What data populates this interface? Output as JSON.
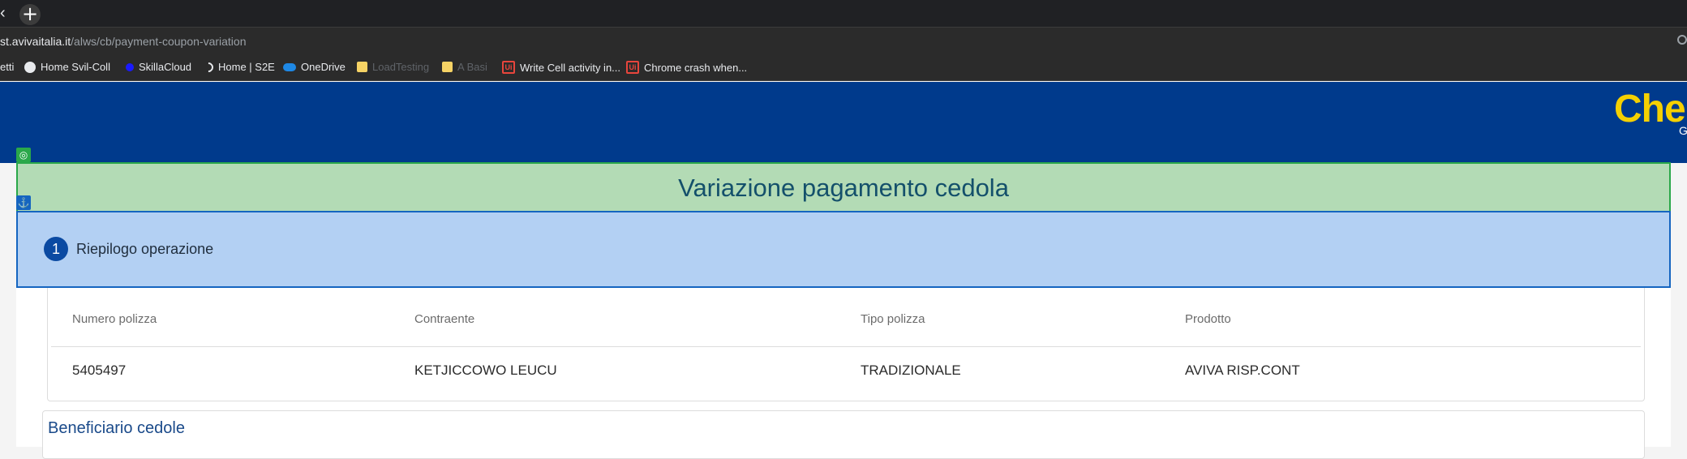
{
  "browser": {
    "tab_close": "‹",
    "new_tab": "+",
    "url_host": "st.avivaitalia.it",
    "url_path": "/alws/cb/payment-coupon-variation",
    "bookmarks": [
      {
        "label": "etti",
        "icon": "none",
        "dim": false
      },
      {
        "label": "Home Svil-Coll",
        "icon": "globe-icon",
        "dim": false
      },
      {
        "label": "SkillaCloud",
        "icon": "skilla-icon",
        "dim": false
      },
      {
        "label": "Home | S2E",
        "icon": "moon-icon",
        "dim": false
      },
      {
        "label": "OneDrive",
        "icon": "onedrive-icon",
        "dim": false
      },
      {
        "label": "LoadTesting",
        "icon": "folder-icon",
        "dim": true
      },
      {
        "label": "A Basi",
        "icon": "folder-icon",
        "dim": true
      },
      {
        "label": "Write Cell activity in...",
        "icon": "uipath-icon",
        "dim": false
      },
      {
        "label": "Chrome crash when...",
        "icon": "uipath-icon",
        "dim": false
      }
    ]
  },
  "header": {
    "logo_text": "CheB",
    "logo_sub": "G"
  },
  "page": {
    "title": "Variazione pagamento cedola",
    "step_number": "1",
    "step_label": "Riepilogo operazione",
    "table": {
      "headers": [
        "Numero polizza",
        "Contraente",
        "Tipo polizza",
        "Prodotto"
      ],
      "row": [
        "5405497",
        "KETJICCOWO LEUCU",
        "TRADIZIONALE",
        "AVIVA RISP.CONT"
      ]
    },
    "section_title": "Beneficiario cedole"
  },
  "colors": {
    "header_bg": "#003a8c",
    "logo": "#f5d000",
    "title_band": "#b3dbb5",
    "step_band": "#b3d0f3",
    "accent_blue": "#0b4aa2"
  }
}
